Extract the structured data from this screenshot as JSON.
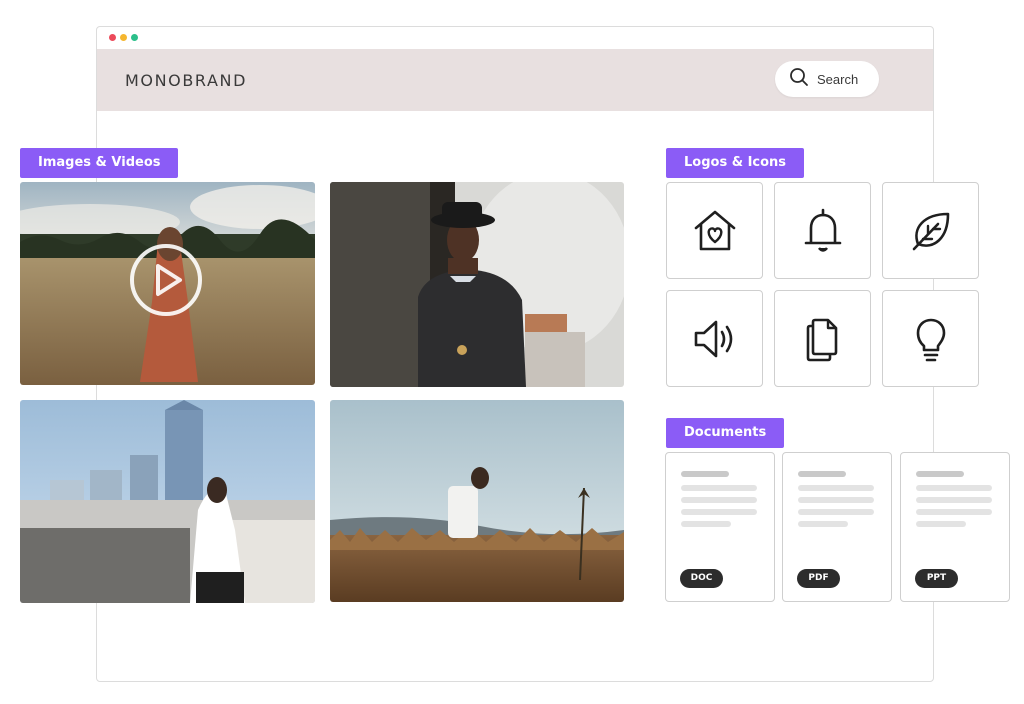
{
  "window": {
    "dots": [
      "#ec4a5a",
      "#f5b62f",
      "#2bbf8a"
    ]
  },
  "header": {
    "brand": "MONOBRAND",
    "search_label": "Search",
    "background": "#e8e0e0"
  },
  "accent_color": "#8b5cf6",
  "sections": {
    "media": {
      "label": "Images & Videos"
    },
    "icons": {
      "label": "Logos & Icons",
      "items": [
        "house-heart-icon",
        "bell-icon",
        "leaf-icon",
        "speaker-icon",
        "documents-icon",
        "lightbulb-icon"
      ]
    },
    "documents": {
      "label": "Documents",
      "items": [
        {
          "type": "DOC"
        },
        {
          "type": "PDF"
        },
        {
          "type": "PPT"
        }
      ]
    }
  }
}
